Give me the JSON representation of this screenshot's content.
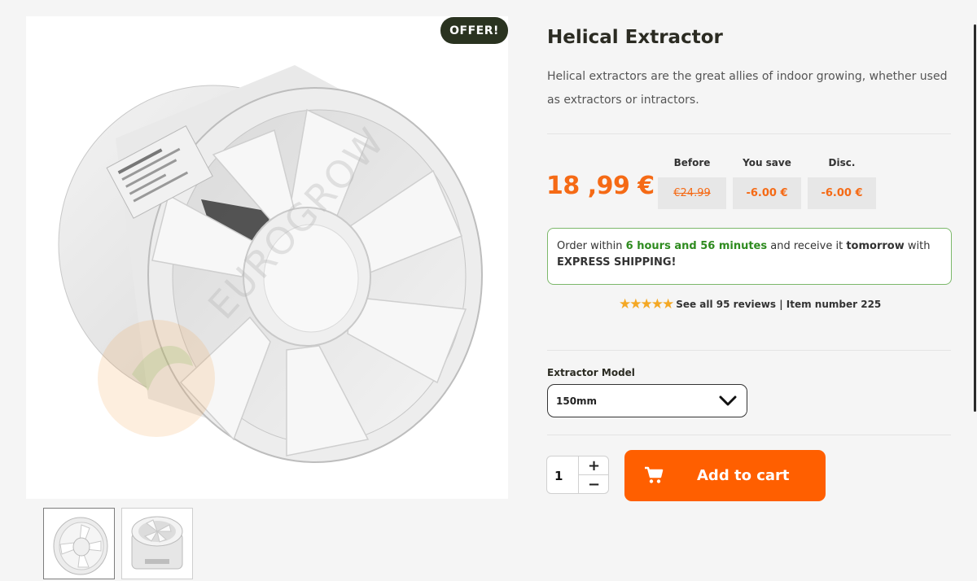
{
  "product": {
    "badge": "OFFER!",
    "title": "Helical Extractor",
    "description": "Helical extractors are the great allies of indoor growing, whether used as extractors or intractors.",
    "watermark": "EUROGROW"
  },
  "pricing": {
    "price": "18 ,99 €",
    "before_label": "Before",
    "save_label": "You save",
    "disc_label": "Disc.",
    "before_value": "€24.99",
    "save_value": "-6.00 €",
    "disc_value": "-6.00 €"
  },
  "shipping": {
    "prefix": "Order within",
    "time": "6 hours and 56 minutes",
    "middle": "and receive it",
    "day": "tomorrow",
    "suffix": "with",
    "method": "EXPRESS SHIPPING!"
  },
  "reviews": {
    "rating": 5,
    "text": "See all 95 reviews | Item number 225"
  },
  "options": {
    "label": "Extractor Model",
    "selected": "150mm"
  },
  "cart": {
    "quantity": "1",
    "plus": "+",
    "minus": "−",
    "add_label": "Add to cart"
  },
  "colors": {
    "accent": "#ff5f00",
    "price": "#f56a15",
    "badge_bg": "#2a3320",
    "ship_border": "#7cb86a",
    "ship_highlight": "#2e8b1f"
  }
}
